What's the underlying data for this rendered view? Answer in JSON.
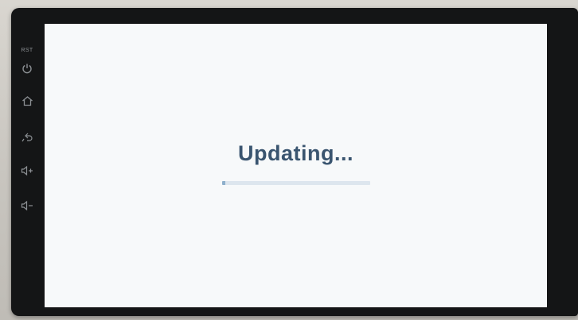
{
  "device": {
    "reset_label": "RST",
    "buttons": [
      {
        "icon": "power-icon"
      },
      {
        "icon": "home-icon"
      },
      {
        "icon": "back-icon"
      },
      {
        "icon": "volume-up-icon"
      },
      {
        "icon": "volume-down-icon"
      }
    ]
  },
  "screen": {
    "status_text": "Updating...",
    "progress": 0.02,
    "colors": {
      "text": "#3a5570",
      "track": "#dde6ee",
      "fill": "#8fb0cc",
      "background": "#f7f9fa"
    }
  }
}
